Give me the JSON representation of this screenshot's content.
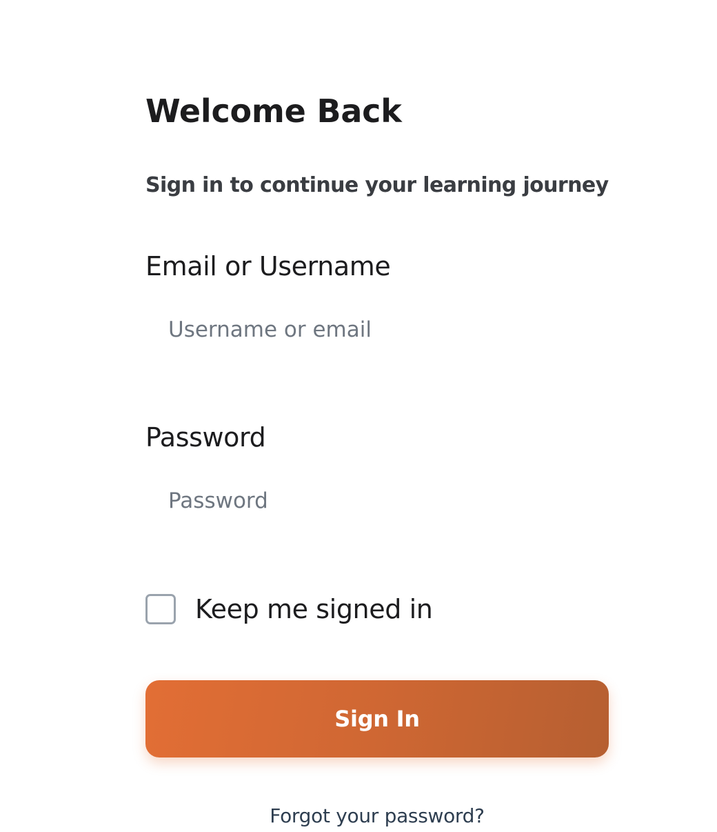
{
  "header": {
    "title": "Welcome Back",
    "subtitle": "Sign in to continue your learning journey"
  },
  "form": {
    "email": {
      "label": "Email or Username",
      "placeholder": "Username or email",
      "value": ""
    },
    "password": {
      "label": "Password",
      "placeholder": "Password",
      "value": ""
    },
    "remember": {
      "label": "Keep me signed in",
      "checked": false
    },
    "submit_label": "Sign In",
    "forgot_label": "Forgot your password?"
  },
  "colors": {
    "accent_start": "#e26e35",
    "accent_end": "#b65f31",
    "text_primary": "#1c1c1e",
    "placeholder": "#6e7680",
    "link": "#2e3e50",
    "checkbox_border": "#9aa3ad"
  }
}
